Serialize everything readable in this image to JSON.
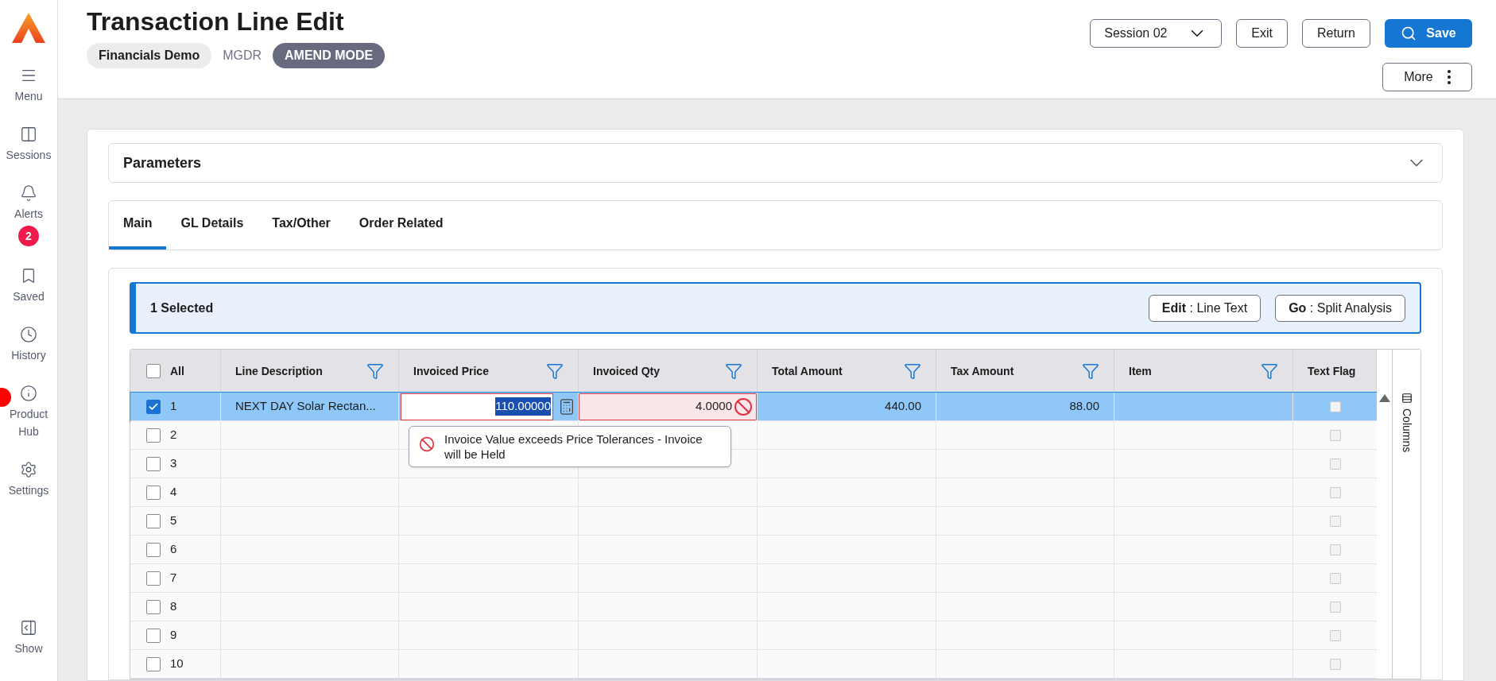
{
  "sidebar": {
    "items": [
      {
        "label": "Menu"
      },
      {
        "label": "Sessions"
      },
      {
        "label": "Alerts",
        "badge": "2"
      },
      {
        "label": "Saved"
      },
      {
        "label": "History"
      },
      {
        "label": "Product Hub"
      },
      {
        "label": "Settings"
      }
    ],
    "bottom_item": {
      "label": "Show"
    }
  },
  "header": {
    "title": "Transaction Line Edit",
    "company": "Financials Demo",
    "code": "MGDR",
    "mode": "AMEND MODE",
    "session": "Session 02",
    "buttons": [
      "Exit",
      "Return"
    ],
    "save": "Save",
    "more": "More"
  },
  "parameters": {
    "title": "Parameters",
    "expanded": false
  },
  "tabs": [
    {
      "label": "Main",
      "selected": true
    },
    {
      "label": "GL Details",
      "selected": false
    },
    {
      "label": "Tax/Other",
      "selected": false
    },
    {
      "label": "Order Related",
      "selected": false
    }
  ],
  "selection_bar": {
    "count": "1 Selected",
    "actions": [
      "**Edit** : Line Text",
      "**Go** : Split Analysis"
    ]
  },
  "table": {
    "all_label": "All",
    "all_checked": false,
    "columns": [
      {
        "label": "Line Description",
        "filter": true
      },
      {
        "label": "Invoiced Price",
        "filter": true
      },
      {
        "label": "Invoiced Qty",
        "filter": true
      },
      {
        "label": "Total Amount",
        "filter": true
      },
      {
        "label": "Tax Amount",
        "filter": true
      },
      {
        "label": "Item",
        "filter": true
      },
      {
        "label": "Text Flag",
        "filter": false
      }
    ],
    "columns_panel": "Columns",
    "rows": [
      {
        "number": "1",
        "checked": true,
        "selected": true,
        "line_description": "NEXT DAY Solar Rectan...",
        "invoiced_price": "110.00000",
        "price_error": true,
        "invoiced_qty": "4.0000",
        "qty_error": true,
        "total_amount": "440.00",
        "tax_amount": "88.00",
        "text_flag": false
      },
      {
        "number": "2",
        "checked": false,
        "selected": false,
        "text_flag": false
      },
      {
        "number": "3",
        "checked": false,
        "selected": false,
        "text_flag": false
      },
      {
        "number": "4",
        "checked": false,
        "selected": false,
        "text_flag": false
      },
      {
        "number": "5",
        "checked": false,
        "selected": false,
        "text_flag": false
      },
      {
        "number": "6",
        "checked": false,
        "selected": false,
        "text_flag": false
      },
      {
        "number": "7",
        "checked": false,
        "selected": false,
        "text_flag": false
      },
      {
        "number": "8",
        "checked": false,
        "selected": false,
        "text_flag": false
      },
      {
        "number": "9",
        "checked": false,
        "selected": false,
        "text_flag": false
      },
      {
        "number": "10",
        "checked": false,
        "selected": false,
        "text_flag": false
      }
    ],
    "error_tooltip": "Invoice Value exceeds Price Tolerances - Invoice will be Held"
  }
}
